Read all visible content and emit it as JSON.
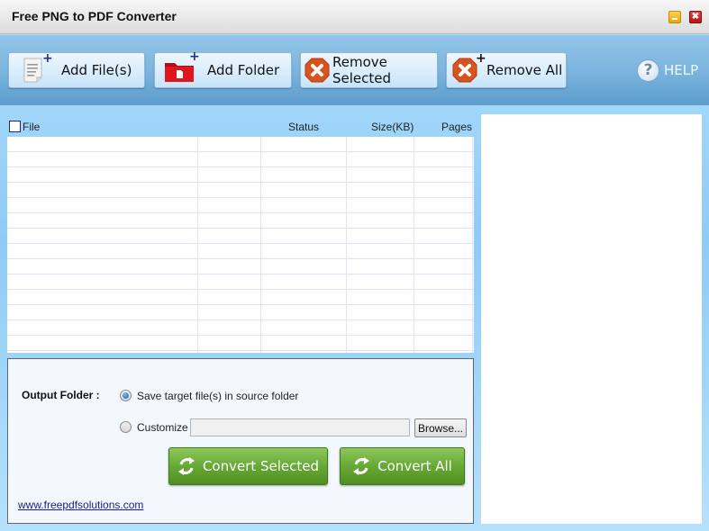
{
  "window": {
    "title": "Free PNG to PDF Converter",
    "minimize_icon": "minimize-icon",
    "close_icon": "close-icon",
    "close_glyph": "✖"
  },
  "toolbar": {
    "add_files": {
      "label": "Add File(s)",
      "icon": "add-file-icon"
    },
    "add_folder": {
      "label": "Add Folder",
      "icon": "add-folder-icon"
    },
    "remove_selected": {
      "label": "Remove Selected",
      "icon": "remove-icon"
    },
    "remove_all": {
      "label": "Remove All",
      "icon": "remove-all-icon"
    },
    "help": {
      "label": "HELP",
      "icon": "help-icon",
      "glyph": "?"
    },
    "plus_glyph": "+"
  },
  "file_list": {
    "select_all_checked": false,
    "columns": [
      "File",
      "Status",
      "Size(KB)",
      "Pages"
    ],
    "rows": []
  },
  "output": {
    "label": "Output Folder :",
    "option_source": "Save target file(s) in source folder",
    "option_source_selected": true,
    "option_custom": "Customize :",
    "option_custom_selected": false,
    "custom_path": "",
    "browse_label": "Browse...",
    "convert_selected_label": "Convert Selected",
    "convert_all_label": "Convert All",
    "website": "www.freepdfsolutions.com"
  },
  "colors": {
    "toolbar_blue": "#7cb5df",
    "convert_green": "#67a936",
    "remove_orange": "#e0531c",
    "folder_red": "#d3141b"
  }
}
